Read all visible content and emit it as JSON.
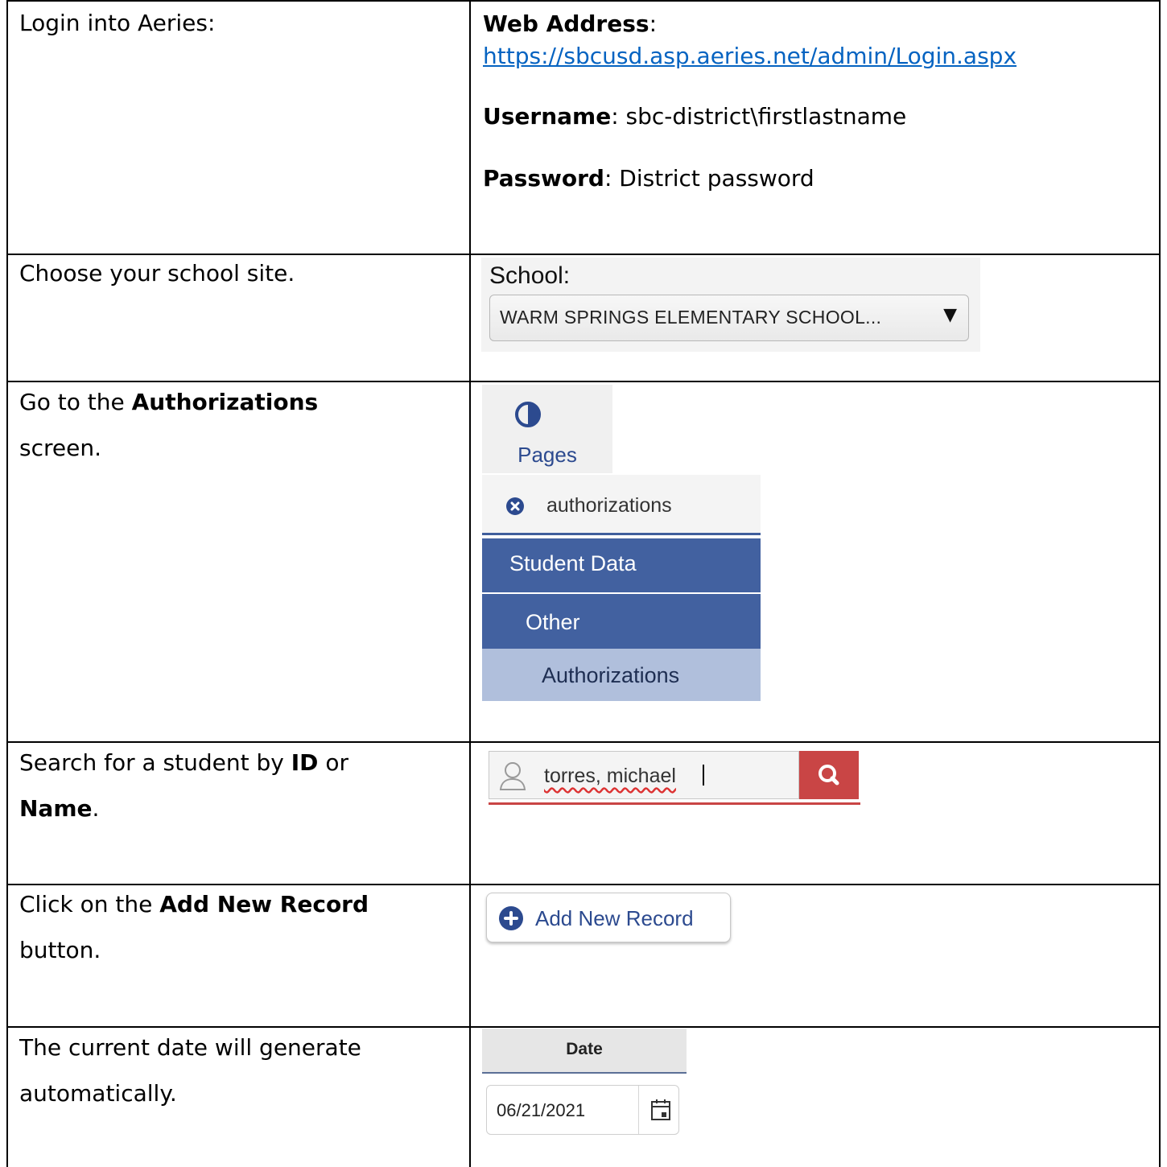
{
  "rows": [
    {
      "step_pre": "Login into Aeries:"
    },
    {
      "step_pre": "Choose your school site."
    },
    {
      "step_pre": "Go to the ",
      "step_bold": "Authorizations",
      "step_post": " screen."
    },
    {
      "step_pre": "Search for a student by ",
      "step_bold": "ID",
      "step_mid": " or ",
      "step_bold2": "Name",
      "step_post": "."
    },
    {
      "step_pre": "Click on the ",
      "step_bold": "Add New Record",
      "step_post": " button."
    },
    {
      "step_pre": "The current date will generate automatically."
    }
  ],
  "login": {
    "web_label": "Web Address",
    "url": "https://sbcusd.asp.aeries.net/admin/Login.aspx",
    "username_label": "Username",
    "username_value": "sbc-district\\firstlastname",
    "password_label": "Password",
    "password_value": "District password",
    "colon": ":"
  },
  "school": {
    "label": "School:",
    "selected": "WARM SPRINGS ELEMENTARY SCHOOL..."
  },
  "nav": {
    "pages_label": "Pages",
    "search_text": "authorizations",
    "items": [
      "Student Data",
      "Other",
      "Authorizations"
    ],
    "accent": "#4261a0",
    "active_bg": "#b0bfdc"
  },
  "student_search": {
    "value": "torres, michael",
    "button_color": "#c94545"
  },
  "add_record": {
    "label": "Add New Record"
  },
  "date": {
    "header": "Date",
    "value": "06/21/2021"
  }
}
